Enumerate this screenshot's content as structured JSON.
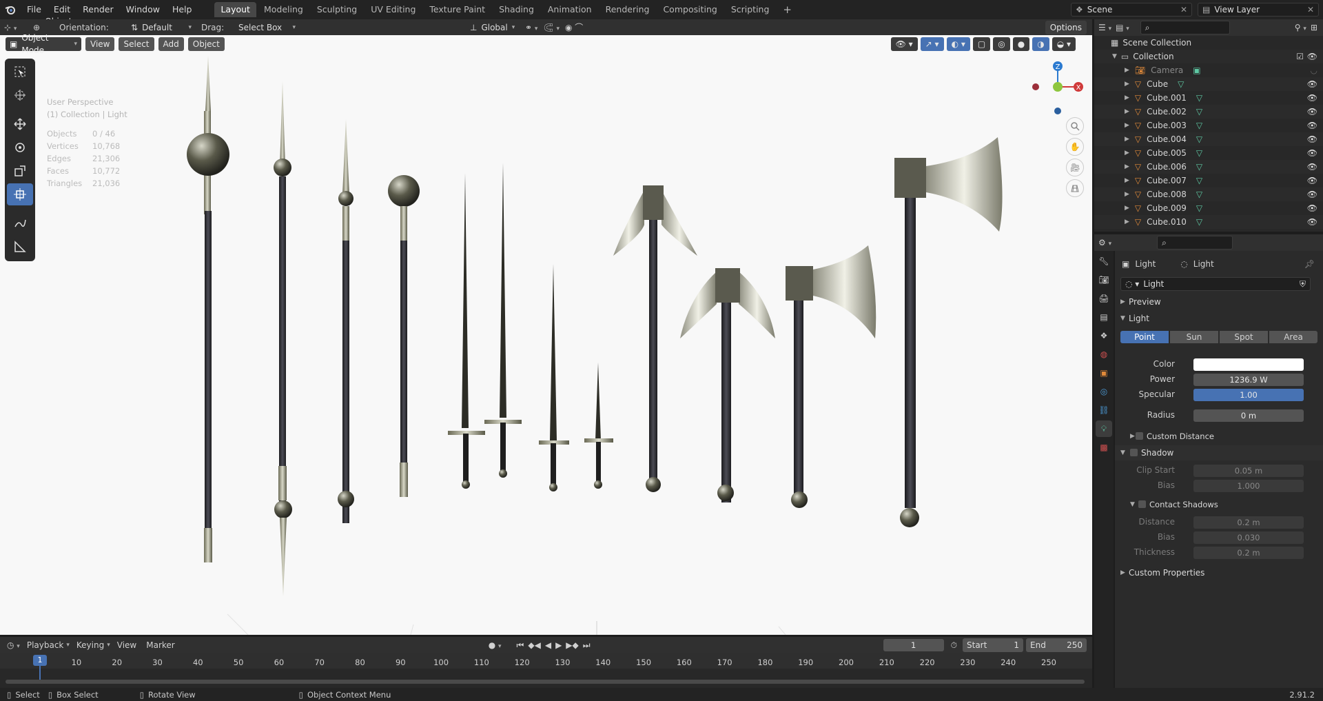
{
  "menu": [
    "File",
    "Edit",
    "Render",
    "Window",
    "Help"
  ],
  "workspaces": [
    "Layout",
    "Modeling",
    "Sculpting",
    "UV Editing",
    "Texture Paint",
    "Shading",
    "Animation",
    "Rendering",
    "Compositing",
    "Scripting"
  ],
  "active_workspace": "Layout",
  "plus": "+",
  "scene": {
    "label": "Scene",
    "view_layer": "View Layer"
  },
  "vp_header": {
    "mode": "Object Mode",
    "orientation_label": "Orientation:",
    "orientation": "Default",
    "drag_label": "Drag:",
    "drag": "Select Box",
    "view": "View",
    "select": "Select",
    "add": "Add",
    "object": "Object",
    "transform": "Global",
    "options": "Options"
  },
  "overlay": {
    "perspective": "User Perspective",
    "collection": "(1) Collection | Light"
  },
  "stats": [
    {
      "k": "Objects",
      "v": "0 / 46"
    },
    {
      "k": "Vertices",
      "v": "10,768"
    },
    {
      "k": "Edges",
      "v": "21,306"
    },
    {
      "k": "Faces",
      "v": "10,772"
    },
    {
      "k": "Triangles",
      "v": "21,036"
    }
  ],
  "gizmo": {
    "x": "X",
    "y": "Y",
    "z": "Z"
  },
  "outliner": {
    "scene_collection": "Scene Collection",
    "collection": "Collection",
    "items": [
      "Camera",
      "Cube",
      "Cube.001",
      "Cube.002",
      "Cube.003",
      "Cube.004",
      "Cube.005",
      "Cube.006",
      "Cube.007",
      "Cube.008",
      "Cube.009",
      "Cube.010"
    ]
  },
  "props": {
    "breadcrumb1": "Light",
    "breadcrumb2": "Light",
    "datablock": "Light",
    "preview": "Preview",
    "light_panel": "Light",
    "types": [
      "Point",
      "Sun",
      "Spot",
      "Area"
    ],
    "active_type": "Point",
    "color_label": "Color",
    "color": "#ffffff",
    "power_label": "Power",
    "power": "1236.9 W",
    "specular_label": "Specular",
    "specular": "1.00",
    "specular_fraction": 1.0,
    "radius_label": "Radius",
    "radius": "0 m",
    "custom_distance": "Custom Distance",
    "shadow": "Shadow",
    "clip_start_label": "Clip Start",
    "clip_start": "0.05 m",
    "bias_label": "Bias",
    "bias": "1.000",
    "contact_shadows": "Contact Shadows",
    "distance_label": "Distance",
    "distance": "0.2 m",
    "cbias_label": "Bias",
    "cbias": "0.030",
    "thickness_label": "Thickness",
    "thickness": "0.2 m",
    "custom_properties": "Custom Properties"
  },
  "timeline": {
    "playback": "Playback",
    "keying": "Keying",
    "view": "View",
    "marker": "Marker",
    "current_frame": "1",
    "start_label": "Start",
    "start": "1",
    "end_label": "End",
    "end": "250",
    "ticks": [
      "1",
      "10",
      "20",
      "30",
      "40",
      "50",
      "60",
      "70",
      "80",
      "90",
      "100",
      "110",
      "120",
      "130",
      "140",
      "150",
      "160",
      "170",
      "180",
      "190",
      "200",
      "210",
      "220",
      "230",
      "240",
      "250"
    ]
  },
  "status": {
    "select": "Select",
    "box_select": "Box Select",
    "rotate_view": "Rotate View",
    "context_menu": "Object Context Menu",
    "version": "2.91.2"
  },
  "colors": {
    "accent": "#4772b3",
    "header": "#303030",
    "viewport_bg": "#f8f8f8",
    "mesh_icon": "#e08a3a",
    "data_icon": "#5ec9a4"
  }
}
